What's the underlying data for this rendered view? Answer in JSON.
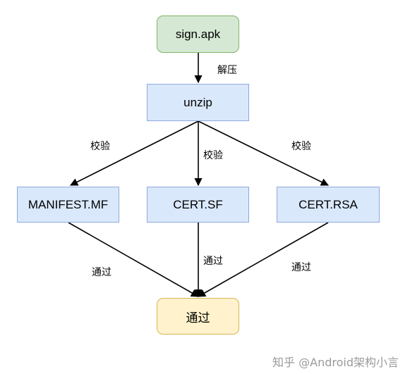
{
  "nodes": {
    "sign_apk": "sign.apk",
    "unzip": "unzip",
    "manifest": "MANIFEST.MF",
    "cert_sf": "CERT.SF",
    "cert_rsa": "CERT.RSA",
    "pass": "通过"
  },
  "edge_labels": {
    "unzip_label": "解压",
    "verify_left": "校验",
    "verify_mid": "校验",
    "verify_right": "校验",
    "pass_left": "通过",
    "pass_mid": "通过",
    "pass_right": "通过"
  },
  "watermark": "知乎 @Android架构小言",
  "colors": {
    "blue_fill": "#dae8fc",
    "green_fill": "#d5e8d4",
    "yellow_fill": "#fff2cc"
  }
}
